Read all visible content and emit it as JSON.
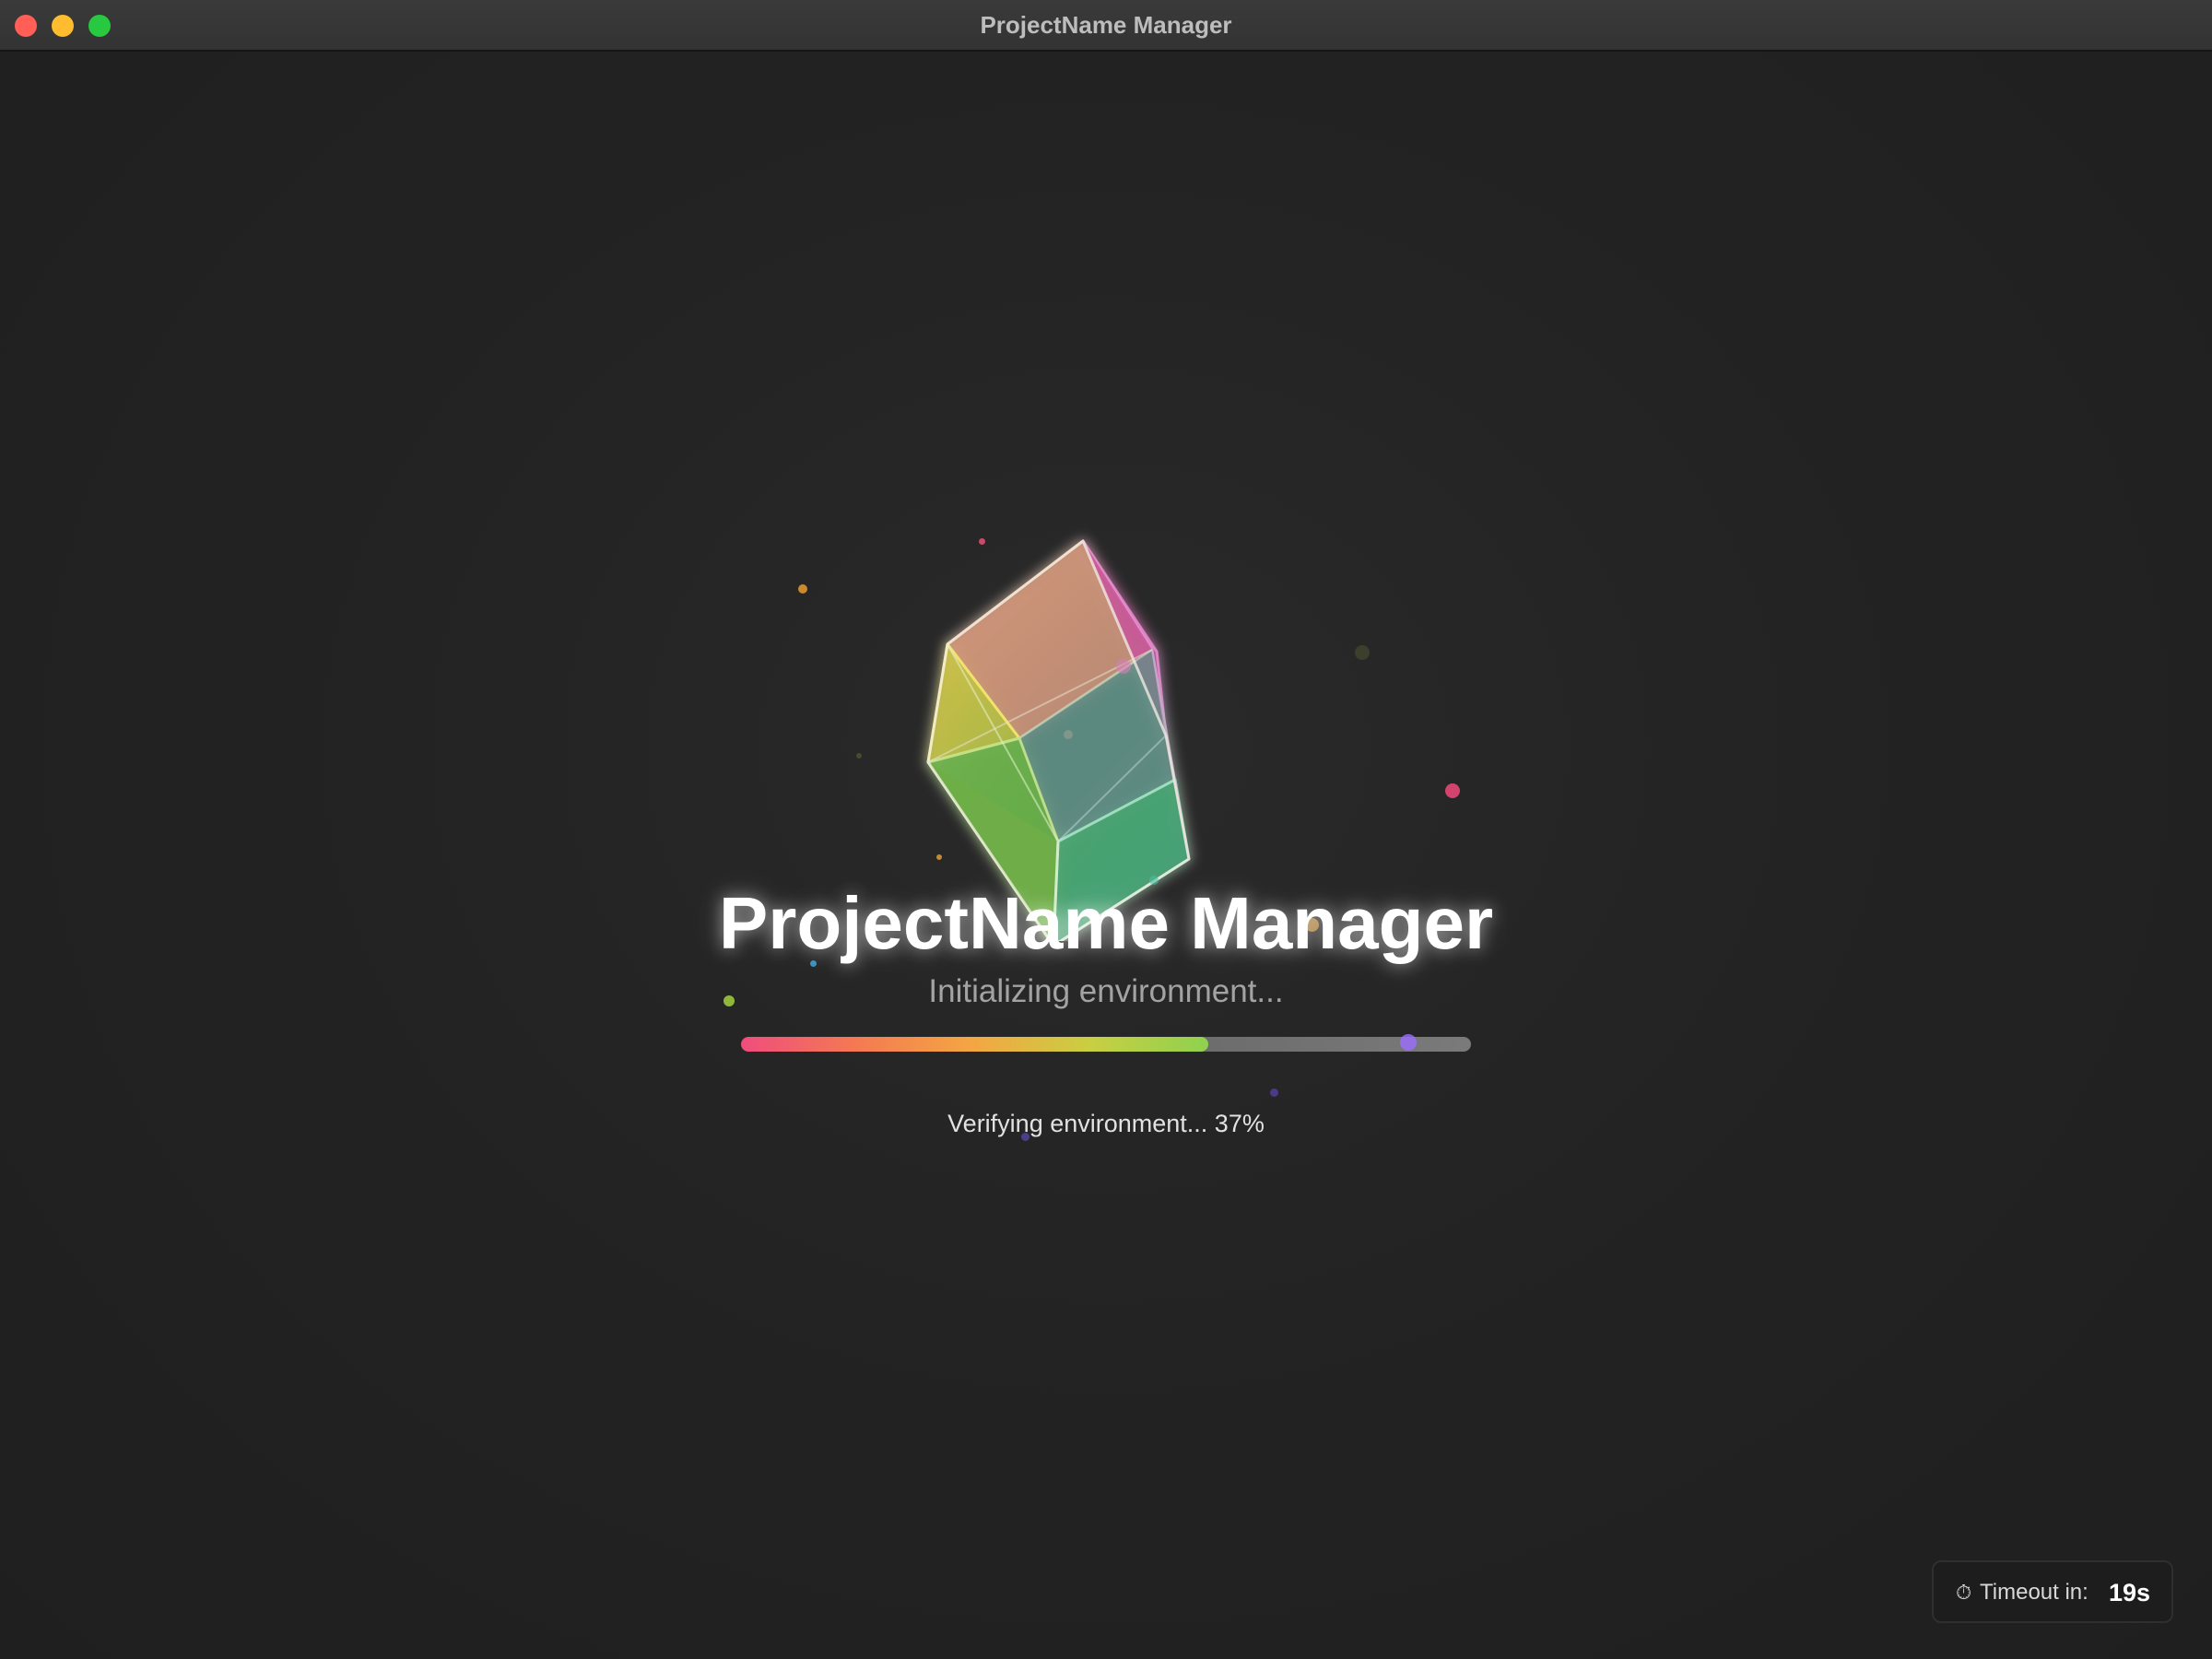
{
  "window": {
    "title": "ProjectName Manager"
  },
  "splash": {
    "app_name": "ProjectName Manager",
    "subtitle": "Initializing environment...",
    "progress": 0.64,
    "status": "Verifying environment... 37%"
  },
  "timeout": {
    "icon": "stopwatch-icon",
    "icon_glyph": "⏱",
    "label": "Timeout in:",
    "value": "19s"
  },
  "colors": {
    "background": "#222222",
    "progress_start": "#ef4d7d",
    "progress_mid": "#f3a742",
    "progress_end": "#8fd14f",
    "close": "#ff5f57",
    "minimize": "#febc2e",
    "zoom": "#28c840"
  }
}
